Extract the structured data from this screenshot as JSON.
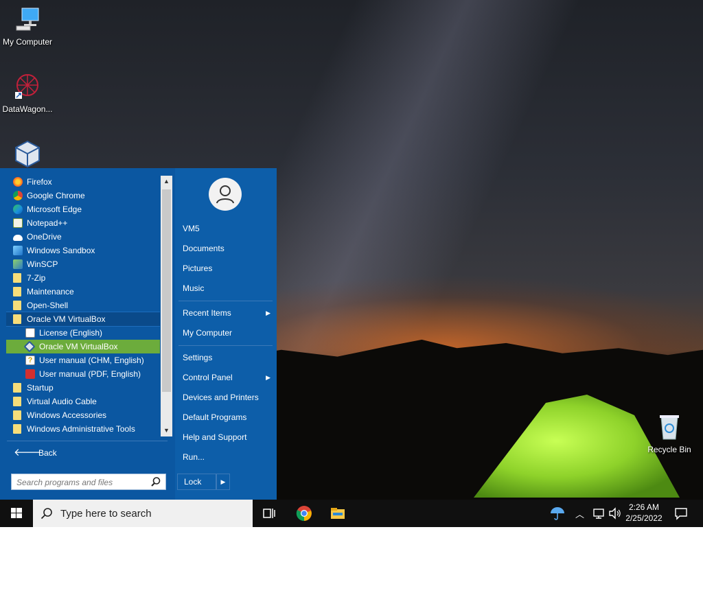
{
  "desktop": {
    "icons": [
      {
        "label": "My Computer"
      },
      {
        "label": "DataWagon..."
      },
      {
        "label": "Oracle VM VirtualBox"
      },
      {
        "label": "Recycle Bin"
      }
    ]
  },
  "start_menu": {
    "programs": [
      {
        "label": "Firefox",
        "icon": "firefox-icon"
      },
      {
        "label": "Google Chrome",
        "icon": "chrome-icon"
      },
      {
        "label": "Microsoft Edge",
        "icon": "edge-icon"
      },
      {
        "label": "Notepad++",
        "icon": "notepad-plus-plus-icon"
      },
      {
        "label": "OneDrive",
        "icon": "onedrive-icon"
      },
      {
        "label": "Windows Sandbox",
        "icon": "windows-sandbox-icon"
      },
      {
        "label": "WinSCP",
        "icon": "winscp-icon"
      },
      {
        "label": "7-Zip",
        "icon": "folder-icon"
      },
      {
        "label": "Maintenance",
        "icon": "folder-icon"
      },
      {
        "label": "Open-Shell",
        "icon": "folder-icon"
      },
      {
        "label": "Oracle VM VirtualBox",
        "icon": "folder-icon"
      },
      {
        "label": "License (English)",
        "icon": "document-icon"
      },
      {
        "label": "Oracle VM VirtualBox",
        "icon": "virtualbox-icon"
      },
      {
        "label": "User manual (CHM, English)",
        "icon": "help-file-icon"
      },
      {
        "label": "User manual (PDF, English)",
        "icon": "pdf-icon"
      },
      {
        "label": "Startup",
        "icon": "folder-icon"
      },
      {
        "label": "Virtual Audio Cable",
        "icon": "folder-icon"
      },
      {
        "label": "Windows Accessories",
        "icon": "folder-icon"
      },
      {
        "label": "Windows Administrative Tools",
        "icon": "folder-icon"
      }
    ],
    "back_label": "Back",
    "search_placeholder": "Search programs and files",
    "right_items": {
      "user": "VM5",
      "documents": "Documents",
      "pictures": "Pictures",
      "music": "Music",
      "recent_items": "Recent Items",
      "my_computer": "My Computer",
      "settings": "Settings",
      "control_panel": "Control Panel",
      "devices_printers": "Devices and Printers",
      "default_programs": "Default Programs",
      "help_support": "Help and Support",
      "run": "Run..."
    },
    "lock_label": "Lock"
  },
  "taskbar": {
    "search_placeholder": "Type here to search",
    "time": "2:26 AM",
    "date": "2/25/2022"
  },
  "colors": {
    "menu_bg": "#0b57a1",
    "highlight": "#6cac3c",
    "taskbar_bg": "#101010"
  }
}
